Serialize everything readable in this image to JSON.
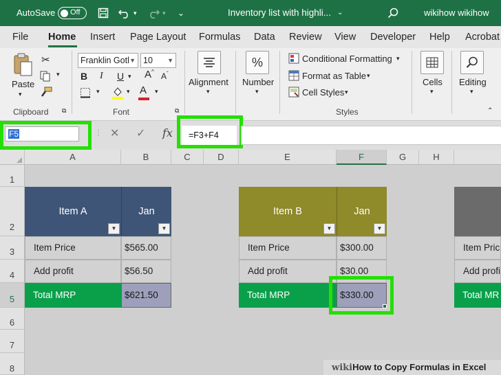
{
  "titlebar": {
    "autosave_label": "AutoSave",
    "autosave_state": "Off",
    "doc_title": "Inventory list with highli...",
    "user_name": "wikihow wikihow"
  },
  "tabs": [
    "File",
    "Home",
    "Insert",
    "Page Layout",
    "Formulas",
    "Data",
    "Review",
    "View",
    "Developer",
    "Help",
    "Acrobat"
  ],
  "ribbon": {
    "clipboard": {
      "paste_label": "Paste",
      "group_label": "Clipboard"
    },
    "font": {
      "font_name": "Franklin Gotl",
      "font_size": "10",
      "bold": "B",
      "italic": "I",
      "underline": "U",
      "group_label": "Font",
      "color_letter": "A"
    },
    "alignment": {
      "label": "Alignment"
    },
    "number": {
      "label": "Number",
      "icon": "%"
    },
    "styles": {
      "conditional_formatting": "Conditional Formatting",
      "format_as_table": "Format as Table",
      "cell_styles": "Cell Styles",
      "group_label": "Styles"
    },
    "cells": {
      "label": "Cells"
    },
    "editing": {
      "label": "Editing"
    }
  },
  "formula_bar": {
    "name_box": "F5",
    "fx": "fx",
    "formula": "=F3+F4"
  },
  "columns": [
    "A",
    "B",
    "C",
    "D",
    "E",
    "F",
    "G",
    "H"
  ],
  "rows": [
    "1",
    "2",
    "3",
    "4",
    "5",
    "6",
    "7",
    "8"
  ],
  "tables": {
    "a": {
      "header_item": "Item A",
      "header_month": "Jan",
      "rows": [
        {
          "label": "Item Price",
          "value": "$565.00"
        },
        {
          "label": "Add profit",
          "value": "$56.50"
        },
        {
          "label": "Total MRP",
          "value": "$621.50"
        }
      ]
    },
    "b": {
      "header_item": "Item B",
      "header_month": "Jan",
      "rows": [
        {
          "label": "Item Price",
          "value": "$300.00"
        },
        {
          "label": "Add profit",
          "value": "$30.00"
        },
        {
          "label": "Total MRP",
          "value": "$330.00"
        }
      ]
    },
    "c": {
      "rows": [
        {
          "label": "Item Pric"
        },
        {
          "label": "Add profi"
        },
        {
          "label": "Total MR"
        }
      ]
    }
  },
  "colors": {
    "excel_green": "#1e7145",
    "header_a": "#3f5578",
    "header_b": "#8f8a2a",
    "header_c": "#6b6b6b",
    "total_green": "#0aa04a",
    "highlight": "#23e000"
  },
  "watermark": {
    "wiki": "wiki",
    "rest": "How to Copy Formulas in Excel"
  }
}
